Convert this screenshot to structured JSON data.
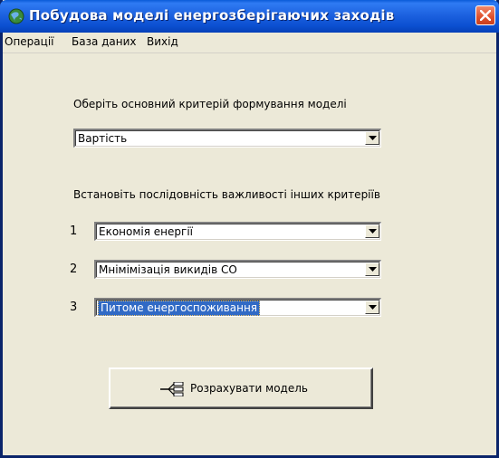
{
  "window": {
    "title": "Побудова моделі енергозберігаючих заходів"
  },
  "menu": {
    "items": [
      "Операції",
      "База даних",
      "Вихід"
    ]
  },
  "main": {
    "criterion_label": "Оберіть основний критерій формування моделі",
    "criterion_value": "Вартість",
    "sequence_label": "Встановіть послідовність важливості інших критеріїв",
    "rows": [
      {
        "number": "1",
        "value": "Економія енергії"
      },
      {
        "number": "2",
        "value": "Мнімімізація викидів СО"
      },
      {
        "number": "3",
        "value": "Питоме енергоспоживання"
      }
    ],
    "calculate_label": "Розрахувати модель"
  },
  "colors": {
    "titlebar": "#0b4fd0",
    "window_bg": "#ece9d8",
    "selection": "#316ac5",
    "close": "#e0502c"
  }
}
